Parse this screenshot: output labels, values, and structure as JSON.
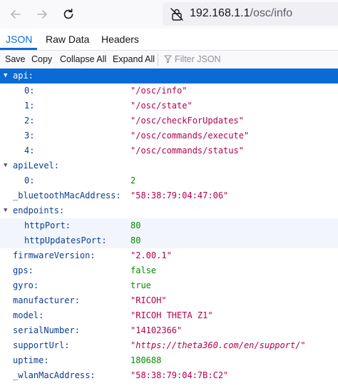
{
  "browser": {
    "url_host": "192.168.1.1",
    "url_path": "/osc/info"
  },
  "tabs": [
    "JSON",
    "Raw Data",
    "Headers"
  ],
  "actions": {
    "save": "Save",
    "copy": "Copy",
    "collapse_all": "Collapse All",
    "expand_all": "Expand All",
    "filter_placeholder": "Filter JSON"
  },
  "rows": [
    {
      "key": "api:",
      "value": ""
    },
    {
      "key": "0:",
      "value": "\"/osc/info\""
    },
    {
      "key": "1:",
      "value": "\"/osc/state\""
    },
    {
      "key": "2:",
      "value": "\"/osc/checkForUpdates\""
    },
    {
      "key": "3:",
      "value": "\"/osc/commands/execute\""
    },
    {
      "key": "4:",
      "value": "\"/osc/commands/status\""
    },
    {
      "key": "apiLevel:",
      "value": ""
    },
    {
      "key": "0:",
      "value": "2"
    },
    {
      "key": "_bluetoothMacAddress:",
      "value": "\"58:38:79:04:47:06\""
    },
    {
      "key": "endpoints:",
      "value": ""
    },
    {
      "key": "httpPort:",
      "value": "80"
    },
    {
      "key": "httpUpdatesPort:",
      "value": "80"
    },
    {
      "key": "firmwareVersion:",
      "value": "\"2.00.1\""
    },
    {
      "key": "gps:",
      "value": "false"
    },
    {
      "key": "gyro:",
      "value": "true"
    },
    {
      "key": "manufacturer:",
      "value": "\"RICOH\""
    },
    {
      "key": "model:",
      "value": "\"RICOH THETA Z1\""
    },
    {
      "key": "serialNumber:",
      "value": "\"14102366\""
    },
    {
      "key": "supportUrl:",
      "value": "\"https://theta360.com/en/support/\""
    },
    {
      "key": "uptime:",
      "value": "180688"
    },
    {
      "key": "_wlanMacAddress:",
      "value": "\"58:38:79:04:7B:C2\""
    }
  ]
}
